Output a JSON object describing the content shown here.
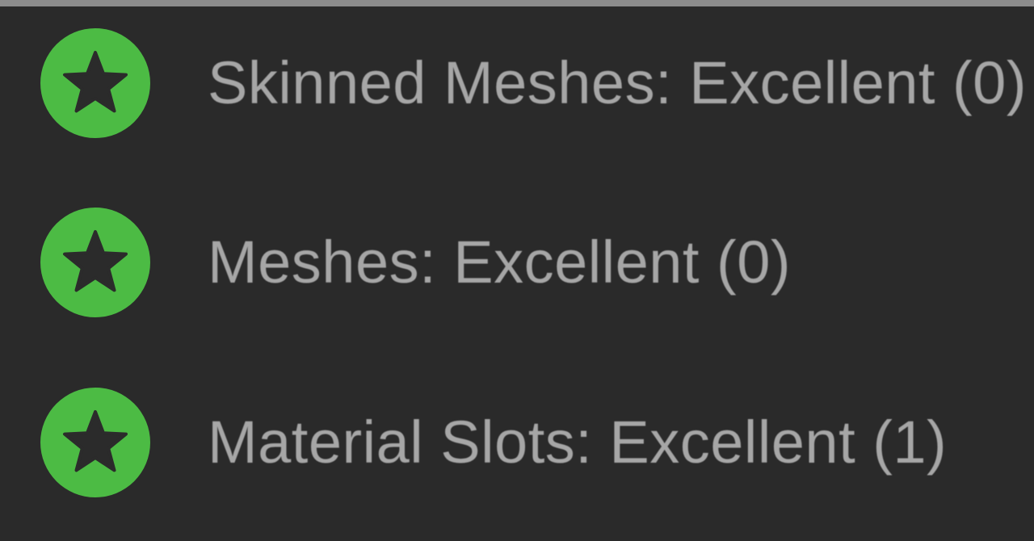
{
  "performance_stats": {
    "rows": [
      {
        "label": "Skinned Meshes: Excellent (0)",
        "rating": "Excellent",
        "icon": "star-icon"
      },
      {
        "label": "Meshes: Excellent (0)",
        "rating": "Excellent",
        "icon": "star-icon"
      },
      {
        "label": "Material Slots: Excellent (1)",
        "rating": "Excellent",
        "icon": "star-icon"
      }
    ]
  },
  "colors": {
    "background": "#2a2a2a",
    "badge_green": "#4cbb44",
    "star_dark": "#2b2b2b",
    "text": "#a6a6a6"
  }
}
